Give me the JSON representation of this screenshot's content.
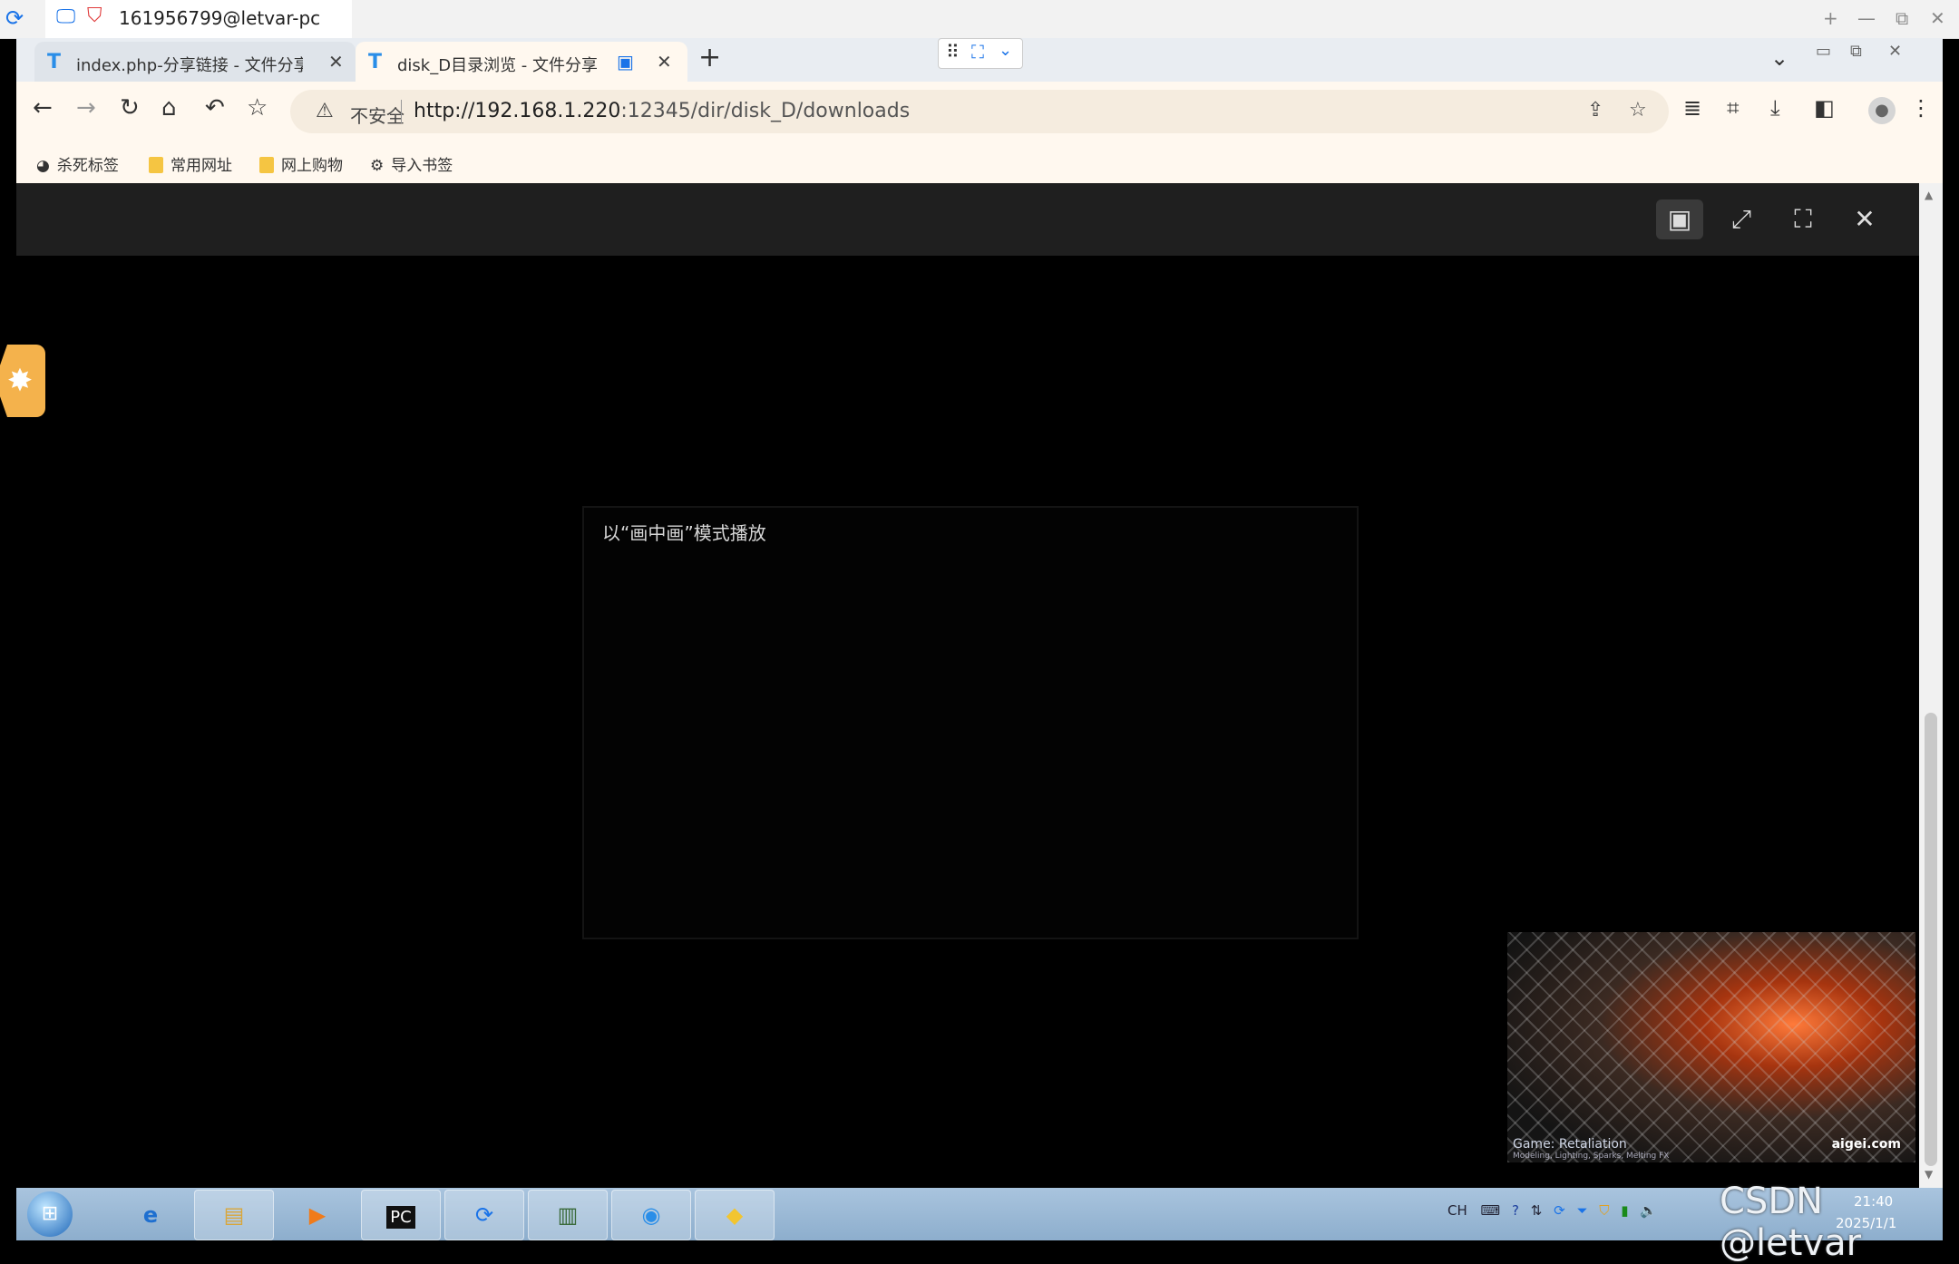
{
  "remote": {
    "title": "161956799@letvar-pc",
    "controls": {
      "new": "+",
      "minimize": "—",
      "restore": "⧉",
      "close": "✕"
    }
  },
  "browser": {
    "tabs": [
      {
        "title": "index.php-分享链接 - 文件分享",
        "close": "✕"
      },
      {
        "title": "disk_D目录浏览 - 文件分享",
        "close": "✕"
      }
    ],
    "new_tab": "+",
    "address": {
      "security_label": "不安全",
      "url_host": "http://192.168.1.220",
      "url_rest": ":12345/dir/disk_D/downloads"
    },
    "bookmarks": [
      "杀死标签",
      "常用网址",
      "网上购物",
      "导入书签"
    ]
  },
  "pip": {
    "label": "以“画中画”模式播放",
    "video_caption": "Game: Retaliation",
    "video_subcaption": "Modeling, Lighting, Sparks, Melting FX",
    "video_brand": "aigei.com"
  },
  "taskbar": {
    "tray_lang": "CH",
    "clock_time": "21:40",
    "clock_date": "2025/1/1"
  },
  "watermark": "CSDN @letvar"
}
